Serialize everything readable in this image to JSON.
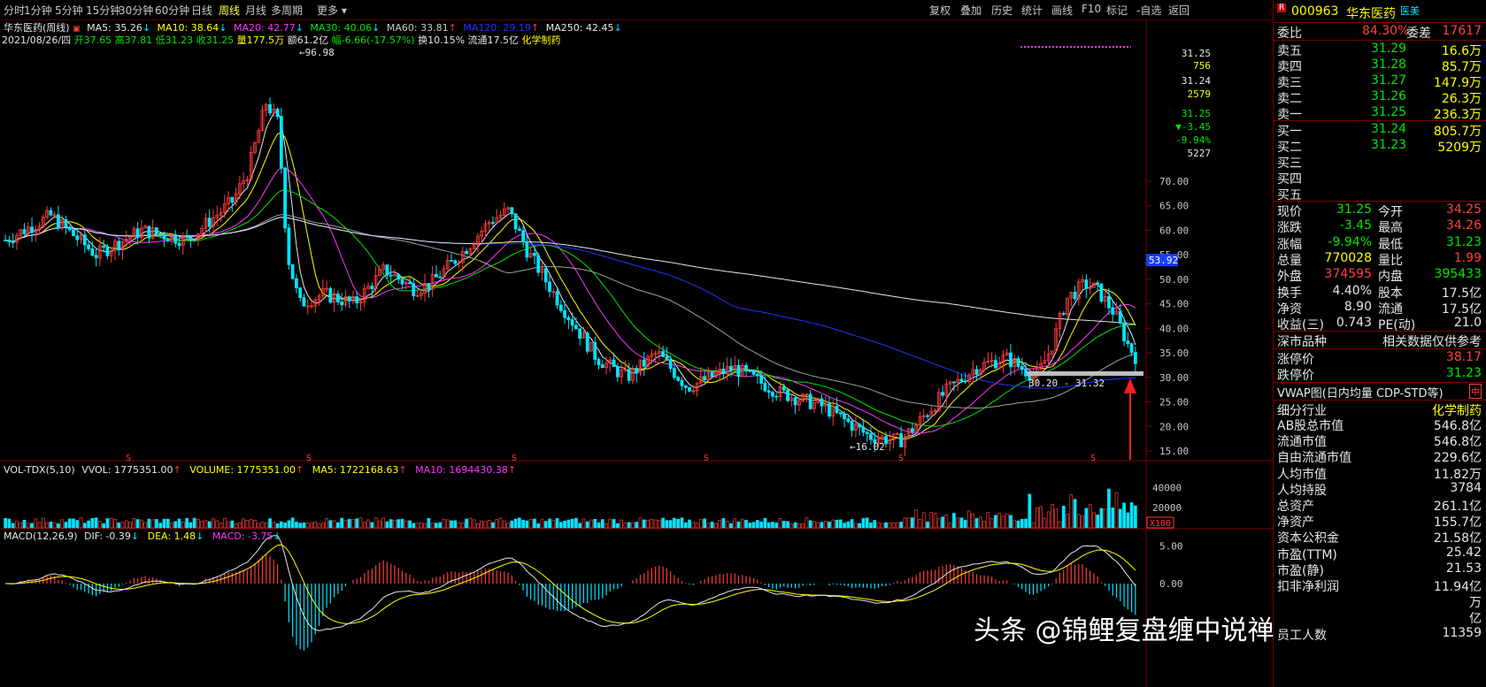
{
  "toolbar": {
    "periods": [
      "分时",
      "1分钟",
      "5分钟",
      "15分钟",
      "30分钟",
      "60分钟",
      "日线",
      "周线",
      "月线",
      "多周期",
      "更多"
    ],
    "active_period": "周线",
    "right_items": [
      "复权",
      "叠加",
      "历史",
      "统计",
      "画线",
      "F10",
      "标记",
      "-自选",
      "返回"
    ]
  },
  "ma_line": {
    "title": "华东医药(周线)",
    "ma5": "MA5: 35.26",
    "ma10": "MA10: 38.64",
    "ma20": "MA20: 42.77",
    "ma30": "MA30: 40.06",
    "ma60": "MA60: 33.81",
    "ma120": "MA120: 29.19",
    "ma250": "MA250: 42.45"
  },
  "bar_info": {
    "date": "2021/08/26/四",
    "open": "开37.65",
    "high": "高37.81",
    "low": "低31.23",
    "close": "收31.25",
    "volume": "量177.5万",
    "amount": "额61.2亿",
    "change": "幅-6.66(-17.57%)",
    "turnover": "换10.15%",
    "float": "流通17.5亿",
    "industry": "化学制药"
  },
  "chart_data": {
    "type": "candlestick",
    "y_ticks": [
      "70.00",
      "65.00",
      "60.00",
      "55.00",
      "50.00",
      "45.00",
      "40.00",
      "35.00",
      "30.00",
      "25.00",
      "20.00",
      "15.00"
    ],
    "ylim": [
      12,
      97
    ],
    "annotations": {
      "high": "96.98",
      "low": "16.02",
      "range": "30.20 - 31.32",
      "current_tag": "53.92"
    },
    "mini_quote": [
      "31.25",
      "756",
      "31.24",
      "2579",
      "31.25",
      "▼-3.45",
      "-9.94%",
      "5227"
    ],
    "volume_ticks": [
      "40000",
      "20000"
    ],
    "volume_unit": "X100",
    "macd_ticks": [
      "5.00",
      "0.00"
    ],
    "series_colors": {
      "up": "#ff3b3b",
      "down": "#00e5ff",
      "ma5": "#e6e6e6",
      "ma10": "#ffff00",
      "ma20": "#ff33ff",
      "ma30": "#00e600",
      "ma60": "#a0a0a0",
      "ma120": "#2233ff",
      "ma250": "#e6e6e6"
    }
  },
  "vol_line": {
    "title": "VOL-TDX(5,10)",
    "vvol": "VVOL: 1775351.00",
    "volume": "VOLUME: 1775351.00",
    "ma5": "MA5: 1722168.63",
    "ma10": "MA10: 1694430.38"
  },
  "macd_line": {
    "title": "MACD(12,26,9)",
    "dif": "DIF: -0.39",
    "dea": "DEA: 1.48",
    "macd": "MACD: -3.75"
  },
  "panel": {
    "code": "000963",
    "name": "华东医药",
    "tag": "医美",
    "weibi_label": "委比",
    "weibi": "84.30%",
    "weicha_label": "委差",
    "weicha": "17617",
    "asks": [
      {
        "label": "卖五",
        "price": "31.29",
        "vol": "16.6万"
      },
      {
        "label": "卖四",
        "price": "31.28",
        "vol": "85.7万"
      },
      {
        "label": "卖三",
        "price": "31.27",
        "vol": "147.9万"
      },
      {
        "label": "卖二",
        "price": "31.26",
        "vol": "26.3万"
      },
      {
        "label": "卖一",
        "price": "31.25",
        "vol": "236.3万"
      }
    ],
    "bids": [
      {
        "label": "买一",
        "price": "31.24",
        "vol": "805.7万"
      },
      {
        "label": "买二",
        "price": "31.23",
        "vol": "5209万"
      },
      {
        "label": "买三",
        "price": "",
        "vol": ""
      },
      {
        "label": "买四",
        "price": "",
        "vol": ""
      },
      {
        "label": "买五",
        "price": "",
        "vol": ""
      }
    ],
    "stats": [
      {
        "l1": "现价",
        "v1": "31.25",
        "l2": "今开",
        "v2": "34.25"
      },
      {
        "l1": "涨跌",
        "v1": "-3.45",
        "l2": "最高",
        "v2": "34.26"
      },
      {
        "l1": "涨幅",
        "v1": "-9.94%",
        "l2": "最低",
        "v2": "31.23"
      },
      {
        "l1": "总量",
        "v1": "770028",
        "l2": "量比",
        "v2": "1.99"
      },
      {
        "l1": "外盘",
        "v1": "374595",
        "l2": "内盘",
        "v2": "395433"
      },
      {
        "l1": "换手",
        "v1": "4.40%",
        "l2": "股本",
        "v2": "17.5亿"
      },
      {
        "l1": "净资",
        "v1": "8.90",
        "l2": "流通",
        "v2": "17.5亿"
      },
      {
        "l1": "收益(三)",
        "v1": "0.743",
        "l2": "PE(动)",
        "v2": "21.0"
      }
    ],
    "market_label": "深市品种",
    "ref_label": "相关数据仅供参考",
    "limit_up_label": "涨停价",
    "limit_up": "38.17",
    "limit_down_label": "跌停价",
    "limit_down": "31.23",
    "vwap_label": "VWAP图(日内均量 CDP-STD等)",
    "vwap_icon": "中",
    "industry_label": "细分行业",
    "industry": "化学制药",
    "fin": [
      {
        "l": "AB股总市值",
        "v": "546.8亿"
      },
      {
        "l": "流通市值",
        "v": "546.8亿"
      },
      {
        "l": "自由流通市值",
        "v": "229.6亿"
      },
      {
        "l": "人均市值",
        "v": "11.82万"
      },
      {
        "l": "人均持股",
        "v": "3784"
      },
      {
        "l": "总资产",
        "v": "261.1亿"
      },
      {
        "l": "净资产",
        "v": "155.7亿"
      },
      {
        "l": "资本公积金",
        "v": "21.58亿"
      },
      {
        "l": "市盈(TTM)",
        "v": "25.42"
      },
      {
        "l": "市盈(静)",
        "v": "21.53"
      },
      {
        "l": "扣非净利润",
        "v": "11.94亿"
      },
      {
        "l": "",
        "v": "万"
      },
      {
        "l": "",
        "v": "亿"
      },
      {
        "l": "员工人数",
        "v": "11359"
      }
    ]
  },
  "watermark": "头条 @锦鲤复盘缠中说禅"
}
